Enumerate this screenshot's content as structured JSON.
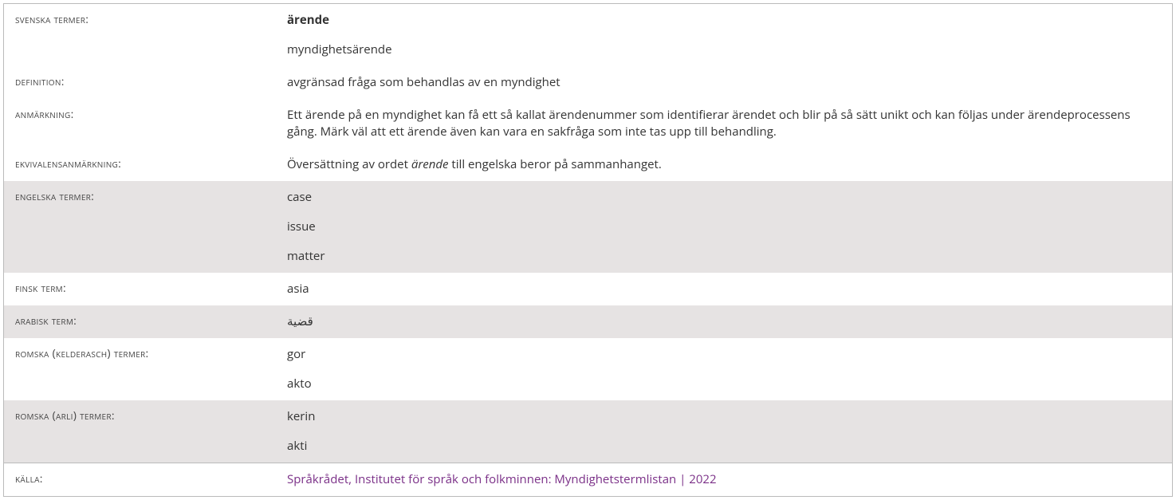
{
  "labels": {
    "svenska": "svenska termer:",
    "definition": "definition:",
    "anmarkning": "anmärkning:",
    "ekvivalens": "ekvivalensanmärkning:",
    "engelska": "engelska termer:",
    "finsk": "finsk term:",
    "arabisk": "arabisk term:",
    "romska_kelderasch": "romska (kelderasch) termer:",
    "romska_arli": "romska (arli) termer:",
    "kalla": "källa:"
  },
  "svenska": {
    "primary": "ärende",
    "secondary": "myndighetsärende"
  },
  "definition": "avgränsad fråga som behandlas av en myndighet",
  "anmarkning": "Ett ärende på en myndighet kan få ett så kallat ärendenummer som identifierar ärendet och blir på så sätt unikt och kan följas under ärendeprocessens gång. Märk väl att ett ärende även kan vara en sakfråga som inte tas upp till behandling.",
  "ekvivalens": {
    "pre": "Översättning av ordet ",
    "italic": "ärende",
    "post": " till engelska beror på sammanhanget."
  },
  "engelska": [
    "case",
    "issue",
    "matter"
  ],
  "finsk": "asia",
  "arabisk": "قضية",
  "romska_kelderasch": [
    "gor",
    "akto"
  ],
  "romska_arli": [
    "kerin",
    "akti"
  ],
  "kalla": "Språkrådet, Institutet för språk och folkminnen: Myndighetstermlistan | 2022"
}
